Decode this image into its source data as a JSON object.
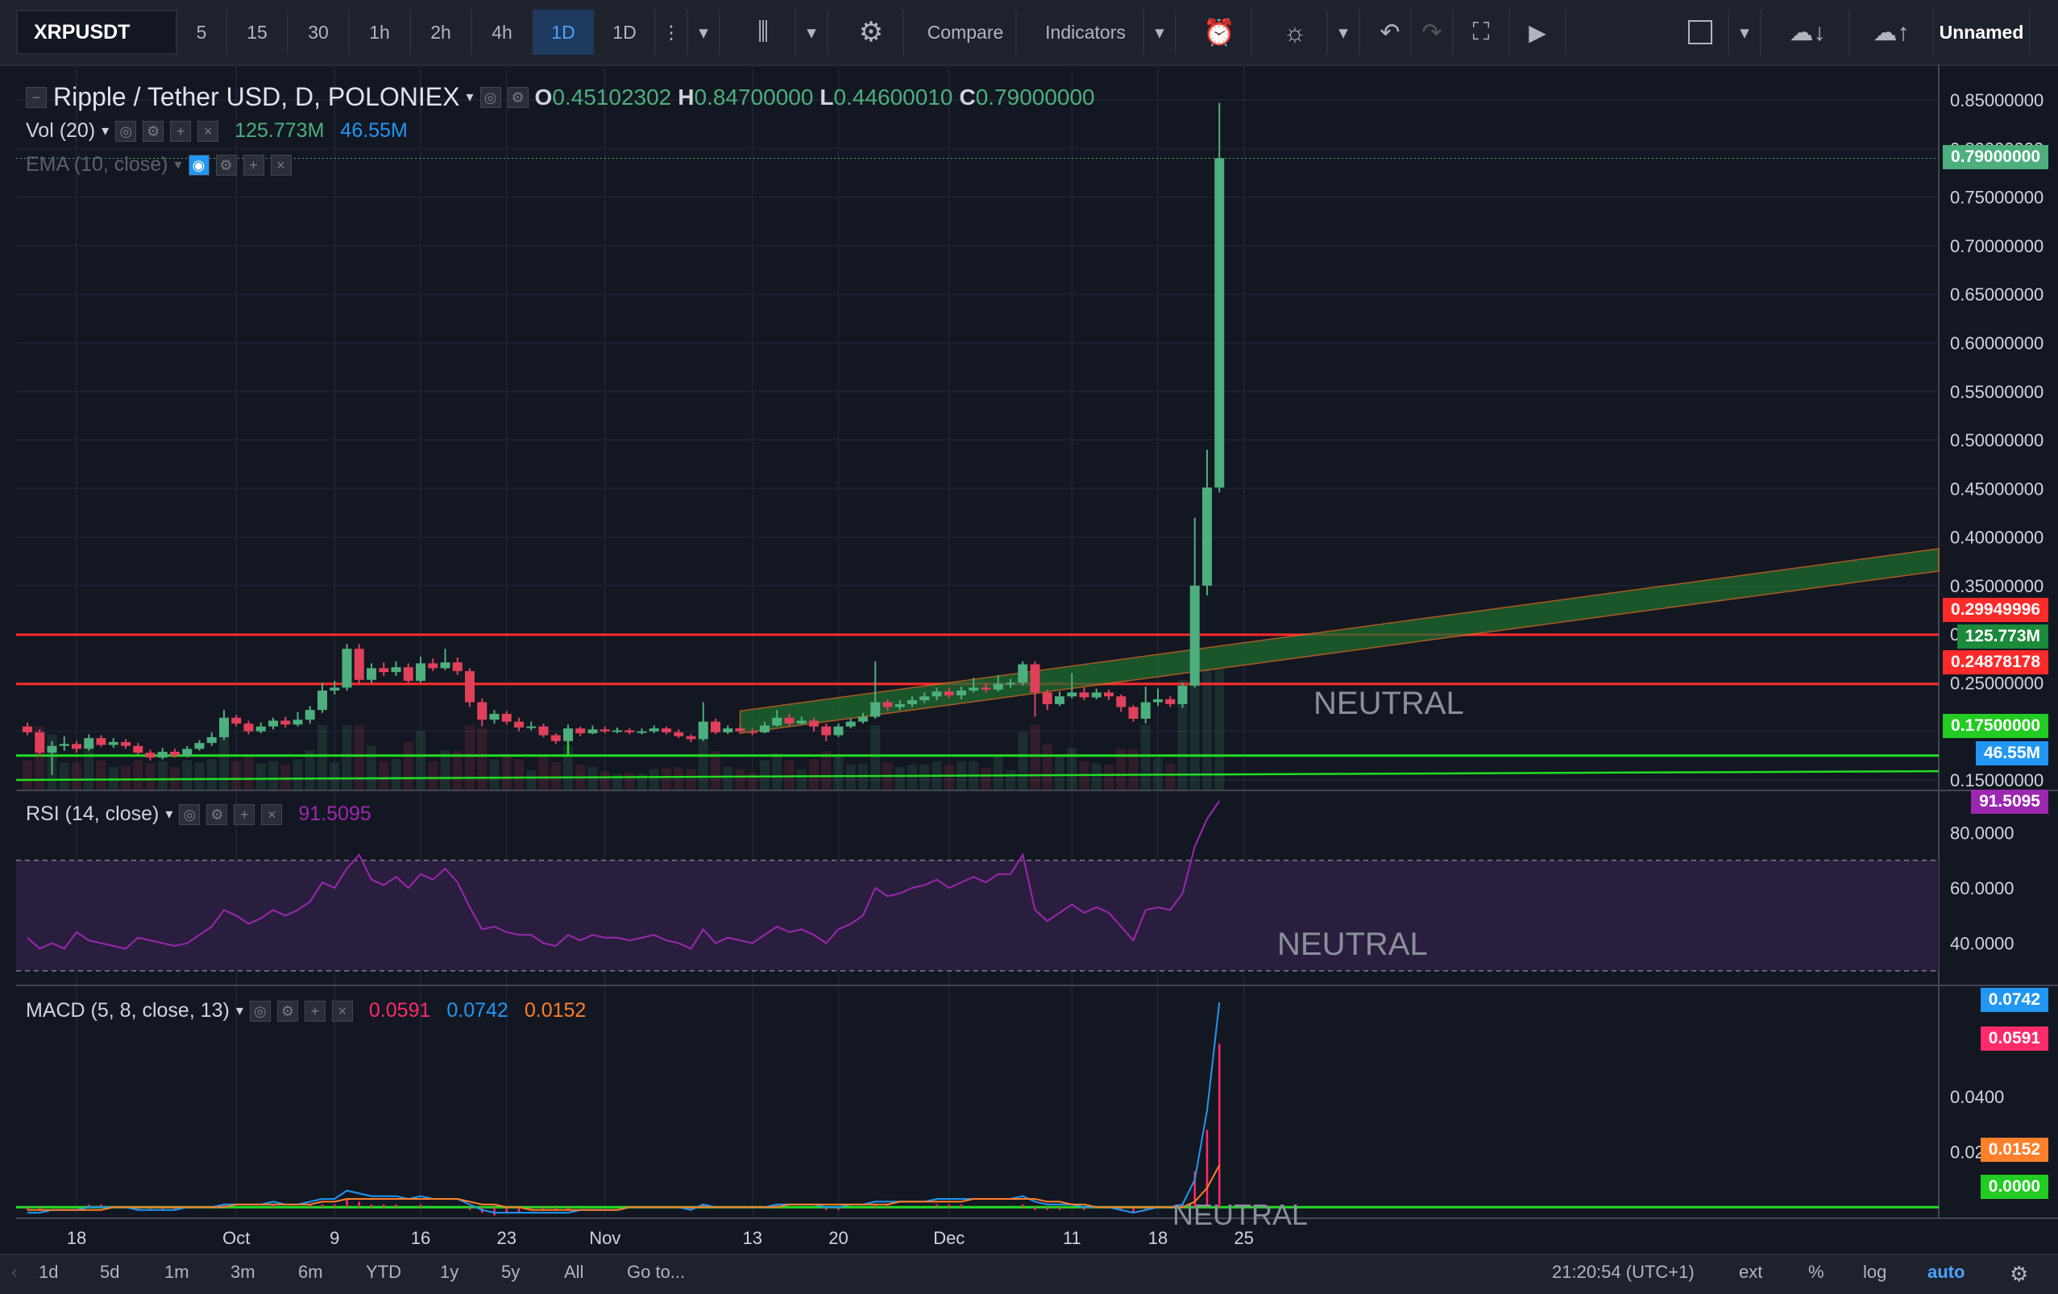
{
  "toolbar": {
    "symbol": "XRPUSDT",
    "intervals": [
      "5",
      "15",
      "30",
      "1h",
      "2h",
      "4h",
      "1D",
      "1D"
    ],
    "active_interval_index": 6,
    "compare_label": "Compare",
    "indicators_label": "Indicators",
    "layout_name": "Unnamed"
  },
  "legend": {
    "title": "Ripple / Tether USD, D, POLONIEX",
    "o_label": "O",
    "o_value": "0.45102302",
    "h_label": "H",
    "h_value": "0.84700000",
    "l_label": "L",
    "l_value": "0.44600010",
    "c_label": "C",
    "c_value": "0.79000000",
    "vol_label": "Vol (20)",
    "vol_value": "125.773M",
    "vol_ma": "46.55M",
    "ema_label": "EMA (10, close)",
    "rsi_label": "RSI (14, close)",
    "rsi_value": "91.5095",
    "macd_label": "MACD (5, 8, close, 13)",
    "macd_hist": "0.0591",
    "macd_line": "0.0742",
    "macd_signal": "0.0152"
  },
  "annotations": {
    "neutral_main": "NEUTRAL",
    "neutral_rsi": "NEUTRAL",
    "neutral_macd": "NEUTRAL"
  },
  "colors": {
    "up": "#4caf7d",
    "down": "#e0405a",
    "resistance": "#ff2a2a",
    "support": "#22dd22",
    "rsi_line": "#9c27b0",
    "macd_line": "#2196f3",
    "signal_line": "#ff7f2a",
    "channel_fill": "#1e6b2e"
  },
  "chart_data": [
    {
      "type": "candlestick",
      "title": "Ripple / Tether USD, D, POLONIEX",
      "ylim": [
        0.14,
        0.87
      ],
      "y_ticks": [
        "0.85000000",
        "0.80000000",
        "0.75000000",
        "0.70000000",
        "0.65000000",
        "0.60000000",
        "0.55000000",
        "0.50000000",
        "0.45000000",
        "0.40000000",
        "0.35000000",
        "0.30000000",
        "0.25000000",
        "0.20000000",
        "0.15000000"
      ],
      "x_tick_labels": [
        "18",
        "Oct",
        "9",
        "16",
        "23",
        "Nov",
        "13",
        "20",
        "Dec",
        "11",
        "18",
        "25"
      ],
      "x_tick_day_index": [
        4,
        17,
        25,
        32,
        39,
        47,
        59,
        66,
        75,
        85,
        92,
        99
      ],
      "candles": [
        [
          0.205,
          0.199,
          0.209,
          0.196
        ],
        [
          0.199,
          0.178,
          0.202,
          0.174
        ],
        [
          0.178,
          0.185,
          0.19,
          0.155
        ],
        [
          0.185,
          0.187,
          0.195,
          0.18
        ],
        [
          0.187,
          0.182,
          0.19,
          0.178
        ],
        [
          0.182,
          0.193,
          0.197,
          0.18
        ],
        [
          0.193,
          0.186,
          0.196,
          0.184
        ],
        [
          0.186,
          0.189,
          0.193,
          0.183
        ],
        [
          0.189,
          0.185,
          0.192,
          0.182
        ],
        [
          0.185,
          0.178,
          0.188,
          0.176
        ],
        [
          0.178,
          0.173,
          0.181,
          0.17
        ],
        [
          0.173,
          0.179,
          0.183,
          0.171
        ],
        [
          0.179,
          0.175,
          0.182,
          0.173
        ],
        [
          0.175,
          0.182,
          0.185,
          0.173
        ],
        [
          0.182,
          0.188,
          0.191,
          0.18
        ],
        [
          0.188,
          0.194,
          0.199,
          0.185
        ],
        [
          0.194,
          0.214,
          0.222,
          0.191
        ],
        [
          0.214,
          0.208,
          0.217,
          0.205
        ],
        [
          0.208,
          0.2,
          0.211,
          0.197
        ],
        [
          0.2,
          0.205,
          0.209,
          0.198
        ],
        [
          0.205,
          0.211,
          0.214,
          0.202
        ],
        [
          0.211,
          0.207,
          0.215,
          0.204
        ],
        [
          0.207,
          0.212,
          0.22,
          0.205
        ],
        [
          0.212,
          0.222,
          0.226,
          0.208
        ],
        [
          0.222,
          0.242,
          0.25,
          0.219
        ],
        [
          0.242,
          0.245,
          0.252,
          0.238
        ],
        [
          0.245,
          0.285,
          0.29,
          0.242
        ],
        [
          0.285,
          0.253,
          0.29,
          0.248
        ],
        [
          0.253,
          0.265,
          0.27,
          0.25
        ],
        [
          0.265,
          0.261,
          0.271,
          0.257
        ],
        [
          0.261,
          0.266,
          0.272,
          0.257
        ],
        [
          0.266,
          0.252,
          0.27,
          0.249
        ],
        [
          0.252,
          0.27,
          0.277,
          0.25
        ],
        [
          0.27,
          0.265,
          0.275,
          0.262
        ],
        [
          0.265,
          0.271,
          0.285,
          0.263
        ],
        [
          0.271,
          0.262,
          0.276,
          0.258
        ],
        [
          0.262,
          0.23,
          0.265,
          0.225
        ],
        [
          0.23,
          0.212,
          0.234,
          0.205
        ],
        [
          0.212,
          0.218,
          0.222,
          0.208
        ],
        [
          0.218,
          0.21,
          0.221,
          0.207
        ],
        [
          0.21,
          0.204,
          0.214,
          0.2
        ],
        [
          0.204,
          0.205,
          0.21,
          0.201
        ],
        [
          0.205,
          0.196,
          0.208,
          0.194
        ],
        [
          0.196,
          0.19,
          0.198,
          0.187
        ],
        [
          0.19,
          0.203,
          0.207,
          0.188
        ],
        [
          0.203,
          0.198,
          0.205,
          0.195
        ],
        [
          0.198,
          0.202,
          0.206,
          0.197
        ],
        [
          0.202,
          0.2,
          0.205,
          0.198
        ],
        [
          0.2,
          0.201,
          0.204,
          0.198
        ],
        [
          0.201,
          0.199,
          0.203,
          0.197
        ],
        [
          0.199,
          0.2,
          0.203,
          0.197
        ],
        [
          0.2,
          0.203,
          0.206,
          0.198
        ],
        [
          0.203,
          0.199,
          0.205,
          0.197
        ],
        [
          0.199,
          0.195,
          0.202,
          0.193
        ],
        [
          0.195,
          0.192,
          0.197,
          0.189
        ],
        [
          0.192,
          0.21,
          0.23,
          0.19
        ],
        [
          0.21,
          0.199,
          0.213,
          0.197
        ],
        [
          0.199,
          0.203,
          0.206,
          0.197
        ],
        [
          0.203,
          0.2,
          0.206,
          0.198
        ],
        [
          0.2,
          0.199,
          0.203,
          0.196
        ],
        [
          0.199,
          0.206,
          0.21,
          0.198
        ],
        [
          0.206,
          0.214,
          0.222,
          0.205
        ],
        [
          0.214,
          0.208,
          0.218,
          0.205
        ],
        [
          0.208,
          0.211,
          0.215,
          0.207
        ],
        [
          0.211,
          0.205,
          0.214,
          0.2
        ],
        [
          0.205,
          0.196,
          0.208,
          0.19
        ],
        [
          0.196,
          0.205,
          0.208,
          0.194
        ],
        [
          0.205,
          0.21,
          0.213,
          0.203
        ],
        [
          0.21,
          0.215,
          0.219,
          0.208
        ],
        [
          0.215,
          0.23,
          0.272,
          0.213
        ],
        [
          0.23,
          0.225,
          0.233,
          0.221
        ],
        [
          0.225,
          0.228,
          0.232,
          0.222
        ],
        [
          0.228,
          0.232,
          0.236,
          0.225
        ],
        [
          0.232,
          0.236,
          0.24,
          0.229
        ],
        [
          0.236,
          0.241,
          0.245,
          0.232
        ],
        [
          0.241,
          0.237,
          0.245,
          0.234
        ],
        [
          0.237,
          0.242,
          0.246,
          0.233
        ],
        [
          0.242,
          0.245,
          0.255,
          0.24
        ],
        [
          0.245,
          0.243,
          0.25,
          0.24
        ],
        [
          0.243,
          0.249,
          0.258,
          0.241
        ],
        [
          0.249,
          0.25,
          0.254,
          0.245
        ],
        [
          0.25,
          0.269,
          0.272,
          0.247
        ],
        [
          0.269,
          0.24,
          0.272,
          0.215
        ],
        [
          0.24,
          0.228,
          0.243,
          0.222
        ],
        [
          0.228,
          0.236,
          0.241,
          0.226
        ],
        [
          0.236,
          0.24,
          0.26,
          0.234
        ],
        [
          0.24,
          0.235,
          0.245,
          0.232
        ],
        [
          0.235,
          0.24,
          0.244,
          0.233
        ],
        [
          0.24,
          0.236,
          0.243,
          0.232
        ],
        [
          0.236,
          0.225,
          0.238,
          0.22
        ],
        [
          0.225,
          0.213,
          0.227,
          0.21
        ],
        [
          0.213,
          0.23,
          0.246,
          0.208
        ],
        [
          0.23,
          0.233,
          0.244,
          0.226
        ],
        [
          0.233,
          0.228,
          0.236,
          0.225
        ],
        [
          0.228,
          0.247,
          0.25,
          0.224
        ],
        [
          0.247,
          0.35,
          0.42,
          0.245
        ],
        [
          0.35,
          0.451,
          0.49,
          0.34
        ],
        [
          0.451,
          0.79,
          0.847,
          0.446
        ]
      ],
      "horizontal_lines": [
        {
          "name": "resistance-upper",
          "price": 0.29949996,
          "color": "resistance",
          "label": "0.29949996"
        },
        {
          "name": "resistance-lower",
          "price": 0.24878178,
          "color": "resistance",
          "label": "0.24878178"
        },
        {
          "name": "support",
          "price": 0.175,
          "color": "support",
          "label": "0.17500000"
        }
      ],
      "support_trend": {
        "start_day": 0,
        "start_price": 0.15,
        "end_day": 113,
        "end_price": 0.159
      },
      "channel": {
        "start_day": 58,
        "lower_start": 0.198,
        "upper_start": 0.221,
        "end_day": 113,
        "lower_end": 0.365,
        "upper_end": 0.388
      },
      "last_price_label": "0.79000000",
      "volume_label": "125.773M",
      "volume_ma_label": "46.55M"
    },
    {
      "type": "line",
      "title": "RSI (14, close)",
      "ylim": [
        25,
        95
      ],
      "y_ticks": [
        "80.0000",
        "60.0000",
        "40.0000"
      ],
      "bands": [
        30,
        70
      ],
      "last_value_label": "91.5095",
      "values": [
        42,
        38,
        40,
        38,
        44,
        41,
        40,
        39,
        38,
        42,
        41,
        40,
        39,
        40,
        43,
        46,
        52,
        50,
        47,
        49,
        52,
        50,
        52,
        55,
        62,
        60,
        67,
        72,
        63,
        61,
        64,
        60,
        65,
        63,
        67,
        62,
        53,
        45,
        46,
        44,
        43,
        43,
        40,
        39,
        43,
        41,
        43,
        42,
        42,
        41,
        42,
        43,
        41,
        40,
        38,
        45,
        40,
        42,
        41,
        40,
        43,
        46,
        44,
        45,
        43,
        40,
        45,
        47,
        50,
        60,
        57,
        58,
        60,
        61,
        63,
        60,
        62,
        64,
        62,
        65,
        65,
        72,
        52,
        48,
        51,
        54,
        51,
        53,
        51,
        46,
        41,
        52,
        53,
        52,
        58,
        75,
        85,
        91.5
      ]
    },
    {
      "type": "line",
      "title": "MACD (5, 8, close, 13)",
      "ylim": [
        -0.004,
        0.08
      ],
      "y_ticks": [
        "0.0400",
        "0.0200"
      ],
      "last_labels": {
        "macd": "0.0742",
        "hist": "0.0591",
        "signal": "0.0152",
        "zero": "0.0000"
      },
      "macd": [
        -0.002,
        -0.002,
        -0.001,
        -0.001,
        -0.001,
        0,
        0,
        0,
        0,
        -0.001,
        -0.001,
        -0.001,
        -0.001,
        0,
        0,
        0,
        0.001,
        0.001,
        0.001,
        0.001,
        0.002,
        0.001,
        0.001,
        0.002,
        0.003,
        0.003,
        0.006,
        0.005,
        0.004,
        0.004,
        0.004,
        0.003,
        0.004,
        0.003,
        0.003,
        0.003,
        0.001,
        -0.001,
        -0.002,
        -0.002,
        -0.002,
        -0.002,
        -0.002,
        -0.002,
        -0.002,
        -0.001,
        -0.001,
        -0.001,
        -0.001,
        0,
        0,
        0,
        0,
        0,
        -0.001,
        0.001,
        0,
        0,
        0,
        0,
        0,
        0.001,
        0.001,
        0.001,
        0.001,
        0,
        0,
        0.001,
        0.001,
        0.002,
        0.002,
        0.002,
        0.002,
        0.002,
        0.003,
        0.003,
        0.003,
        0.003,
        0.003,
        0.003,
        0.003,
        0.004,
        0.002,
        0.001,
        0.001,
        0.001,
        0,
        0,
        0,
        -0.001,
        -0.002,
        -0.001,
        0,
        0,
        0.001,
        0.01,
        0.035,
        0.0742
      ],
      "signal": [
        -0.001,
        -0.001,
        -0.001,
        -0.001,
        -0.001,
        -0.001,
        -0.001,
        0,
        0,
        0,
        0,
        0,
        0,
        0,
        0,
        0,
        0,
        0.001,
        0.001,
        0.001,
        0.001,
        0.001,
        0.001,
        0.001,
        0.002,
        0.002,
        0.003,
        0.003,
        0.003,
        0.003,
        0.003,
        0.003,
        0.003,
        0.003,
        0.003,
        0.003,
        0.002,
        0.001,
        0.001,
        0,
        0,
        -0.001,
        -0.001,
        -0.001,
        -0.001,
        -0.001,
        -0.001,
        -0.001,
        -0.001,
        0,
        0,
        0,
        0,
        0,
        0,
        0,
        0,
        0,
        0,
        0,
        0,
        0,
        0.001,
        0.001,
        0.001,
        0.001,
        0.001,
        0.001,
        0.001,
        0.001,
        0.001,
        0.002,
        0.002,
        0.002,
        0.002,
        0.002,
        0.002,
        0.003,
        0.003,
        0.003,
        0.003,
        0.003,
        0.003,
        0.002,
        0.002,
        0.001,
        0.001,
        0,
        0,
        0,
        0,
        0,
        0,
        0,
        0,
        0.002,
        0.007,
        0.0152
      ],
      "hist": [
        -0.001,
        -0.001,
        0,
        0,
        0,
        0.001,
        0.001,
        0,
        0,
        -0.001,
        -0.001,
        -0.001,
        -0.001,
        0,
        0,
        0,
        0.001,
        0,
        0,
        0,
        0.001,
        0,
        0,
        0.001,
        0.001,
        0.001,
        0.003,
        0.002,
        0.001,
        0.001,
        0.001,
        0,
        0.001,
        0,
        0,
        0,
        -0.001,
        -0.002,
        -0.003,
        -0.002,
        -0.002,
        -0.001,
        -0.001,
        -0.001,
        -0.001,
        0,
        0,
        0,
        0,
        0,
        0,
        0,
        0,
        0,
        -0.001,
        0.001,
        0,
        0,
        0,
        0,
        0,
        0.001,
        0,
        0,
        0,
        -0.001,
        -0.001,
        0,
        0,
        0.001,
        0.001,
        0,
        0,
        0,
        0.001,
        0.001,
        0.001,
        0,
        0,
        0,
        0,
        0.001,
        -0.001,
        -0.001,
        -0.001,
        0,
        -0.001,
        0,
        0,
        -0.001,
        -0.002,
        -0.001,
        0,
        0,
        0.001,
        0.013,
        0.028,
        0.0591
      ]
    }
  ],
  "bottombar": {
    "ranges": [
      "1d",
      "5d",
      "1m",
      "3m",
      "6m",
      "YTD",
      "1y",
      "5y",
      "All",
      "Go to..."
    ],
    "time": "21:20:54 (UTC+1)",
    "options": [
      "ext",
      "%",
      "log",
      "auto"
    ]
  }
}
